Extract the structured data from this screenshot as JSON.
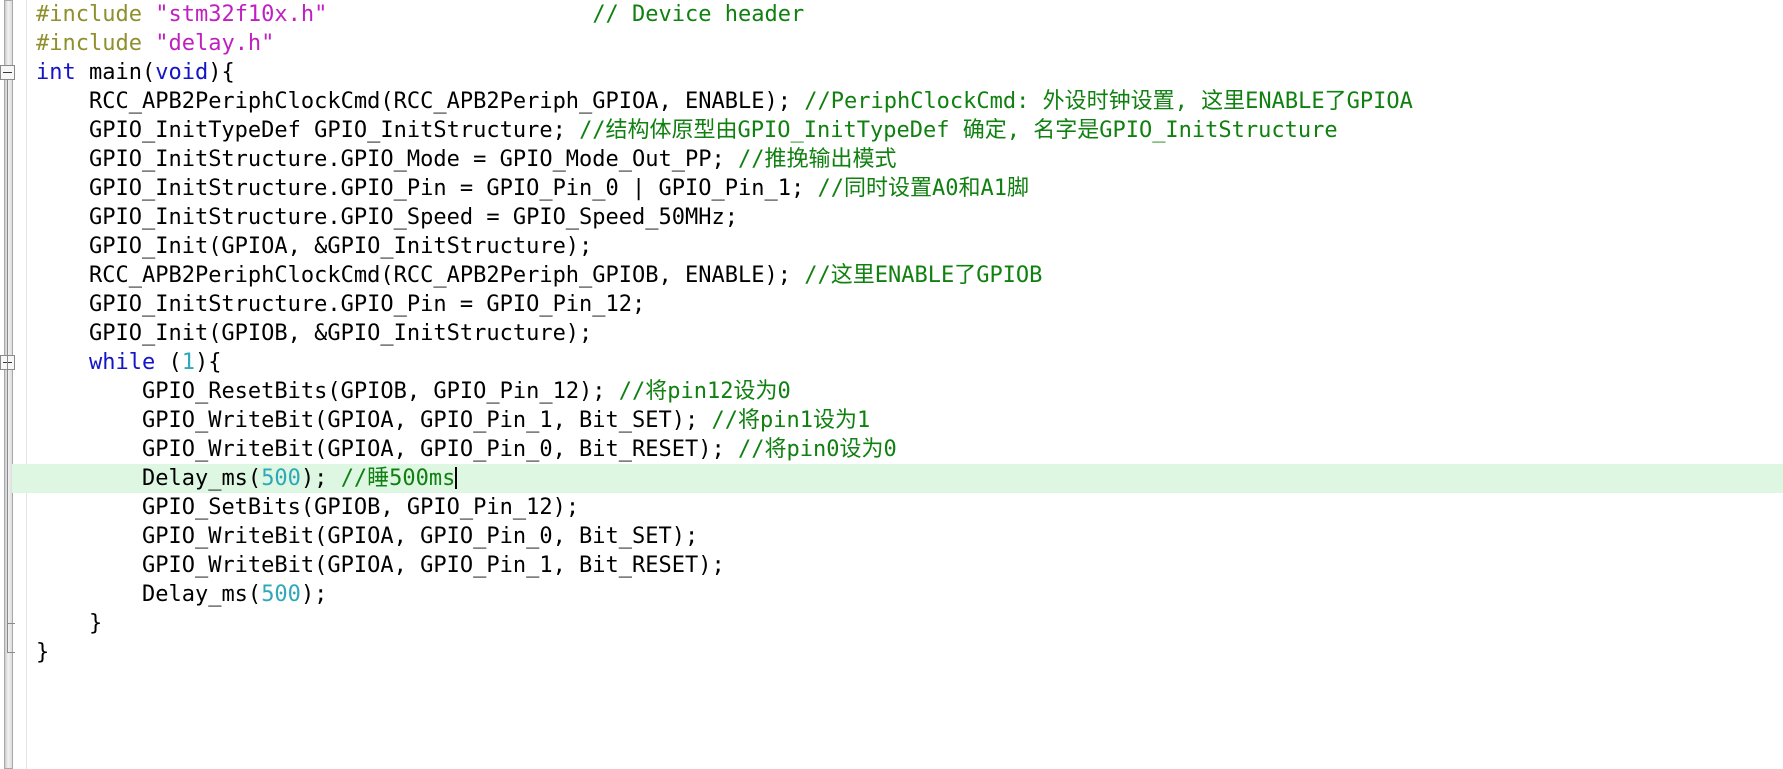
{
  "editor": {
    "language": "C",
    "colors": {
      "preprocessor": "#8f8f2d",
      "string": "#c020c0",
      "keyword": "#1414c8",
      "number": "#2fa8b8",
      "comment": "#108010",
      "plain": "#000000",
      "current_line_background": "#ddf7e3",
      "background": "#ffffff"
    },
    "current_line_index": 15,
    "caret_after_text": "//睡500ms"
  },
  "code_lines": [
    {
      "index": 0,
      "indent": 0,
      "tokens": [
        {
          "t": "#include ",
          "c": "pp"
        },
        {
          "t": "\"stm32f10x.h\"",
          "c": "str"
        },
        {
          "t": "                    ",
          "c": "plain"
        },
        {
          "t": "// Device header",
          "c": "cmt"
        }
      ]
    },
    {
      "index": 1,
      "indent": 0,
      "tokens": [
        {
          "t": "#include ",
          "c": "pp"
        },
        {
          "t": "\"delay.h\"",
          "c": "str"
        }
      ]
    },
    {
      "index": 2,
      "indent": 0,
      "tokens": [
        {
          "t": "int",
          "c": "kw"
        },
        {
          "t": " main(",
          "c": "plain"
        },
        {
          "t": "void",
          "c": "kw"
        },
        {
          "t": "){",
          "c": "plain"
        }
      ]
    },
    {
      "index": 3,
      "indent": 1,
      "tokens": [
        {
          "t": "RCC_APB2PeriphClockCmd(RCC_APB2Periph_GPIOA, ENABLE); ",
          "c": "plain"
        },
        {
          "t": "//PeriphClockCmd: 外设时钟设置, 这里ENABLE了GPIOA",
          "c": "cmt"
        }
      ]
    },
    {
      "index": 4,
      "indent": 1,
      "tokens": [
        {
          "t": "GPIO_InitTypeDef GPIO_InitStructure; ",
          "c": "plain"
        },
        {
          "t": "//结构体原型由GPIO_InitTypeDef 确定, 名字是GPIO_InitStructure",
          "c": "cmt"
        }
      ]
    },
    {
      "index": 5,
      "indent": 1,
      "tokens": [
        {
          "t": "GPIO_InitStructure.GPIO_Mode = GPIO_Mode_Out_PP; ",
          "c": "plain"
        },
        {
          "t": "//推挽输出模式",
          "c": "cmt"
        }
      ]
    },
    {
      "index": 6,
      "indent": 1,
      "tokens": [
        {
          "t": "GPIO_InitStructure.GPIO_Pin = GPIO_Pin_0 | GPIO_Pin_1; ",
          "c": "plain"
        },
        {
          "t": "//同时设置A0和A1脚",
          "c": "cmt"
        }
      ]
    },
    {
      "index": 7,
      "indent": 1,
      "tokens": [
        {
          "t": "GPIO_InitStructure.GPIO_Speed = GPIO_Speed_50MHz;",
          "c": "plain"
        }
      ]
    },
    {
      "index": 8,
      "indent": 1,
      "tokens": [
        {
          "t": "GPIO_Init(GPIOA, &GPIO_InitStructure);",
          "c": "plain"
        }
      ]
    },
    {
      "index": 9,
      "indent": 1,
      "tokens": [
        {
          "t": "RCC_APB2PeriphClockCmd(RCC_APB2Periph_GPIOB, ENABLE); ",
          "c": "plain"
        },
        {
          "t": "//这里ENABLE了GPIOB",
          "c": "cmt"
        }
      ]
    },
    {
      "index": 10,
      "indent": 1,
      "tokens": [
        {
          "t": "GPIO_InitStructure.GPIO_Pin = GPIO_Pin_12;",
          "c": "plain"
        }
      ]
    },
    {
      "index": 11,
      "indent": 1,
      "tokens": [
        {
          "t": "GPIO_Init(GPIOB, &GPIO_InitStructure);",
          "c": "plain"
        }
      ]
    },
    {
      "index": 12,
      "indent": 1,
      "tokens": [
        {
          "t": "while",
          "c": "kw"
        },
        {
          "t": " (",
          "c": "plain"
        },
        {
          "t": "1",
          "c": "num"
        },
        {
          "t": "){",
          "c": "plain"
        }
      ]
    },
    {
      "index": 13,
      "indent": 2,
      "tokens": [
        {
          "t": "GPIO_ResetBits(GPIOB, GPIO_Pin_12); ",
          "c": "plain"
        },
        {
          "t": "//将pin12设为0",
          "c": "cmt"
        }
      ]
    },
    {
      "index": 14,
      "indent": 2,
      "tokens": [
        {
          "t": "GPIO_WriteBit(GPIOA, GPIO_Pin_1, Bit_SET); ",
          "c": "plain"
        },
        {
          "t": "//将pin1设为1",
          "c": "cmt"
        }
      ]
    },
    {
      "index": 15,
      "indent": 2,
      "tokens": [
        {
          "t": "GPIO_WriteBit(GPIOA, GPIO_Pin_0, Bit_RESET); ",
          "c": "plain"
        },
        {
          "t": "//将pin0设为0",
          "c": "cmt"
        }
      ]
    },
    {
      "index": 16,
      "indent": 2,
      "highlighted": true,
      "caret": true,
      "tokens": [
        {
          "t": "Delay_ms(",
          "c": "plain"
        },
        {
          "t": "500",
          "c": "num"
        },
        {
          "t": "); ",
          "c": "plain"
        },
        {
          "t": "//睡500ms",
          "c": "cmt"
        }
      ]
    },
    {
      "index": 17,
      "indent": 2,
      "tokens": [
        {
          "t": "GPIO_SetBits(GPIOB, GPIO_Pin_12);",
          "c": "plain"
        }
      ]
    },
    {
      "index": 18,
      "indent": 2,
      "tokens": [
        {
          "t": "GPIO_WriteBit(GPIOA, GPIO_Pin_0, Bit_SET);",
          "c": "plain"
        }
      ]
    },
    {
      "index": 19,
      "indent": 2,
      "tokens": [
        {
          "t": "GPIO_WriteBit(GPIOA, GPIO_Pin_1, Bit_RESET);",
          "c": "plain"
        }
      ]
    },
    {
      "index": 20,
      "indent": 2,
      "tokens": [
        {
          "t": "Delay_ms(",
          "c": "plain"
        },
        {
          "t": "500",
          "c": "num"
        },
        {
          "t": ");",
          "c": "plain"
        }
      ]
    },
    {
      "index": 21,
      "indent": 1,
      "tokens": [
        {
          "t": "}",
          "c": "plain"
        }
      ]
    },
    {
      "index": 22,
      "indent": 0,
      "tokens": [
        {
          "t": "}",
          "c": "plain"
        }
      ]
    }
  ],
  "fold_markers": [
    {
      "name": "fold-main",
      "line_index": 2,
      "state": "expanded",
      "glyph": "minus-box-icon"
    },
    {
      "name": "fold-while",
      "line_index": 12,
      "state": "expanded",
      "glyph": "minus-box-icon"
    }
  ],
  "scrollbar": {
    "name": "vertical-scrollbar",
    "orientation": "vertical",
    "thumb_full_height": true
  }
}
